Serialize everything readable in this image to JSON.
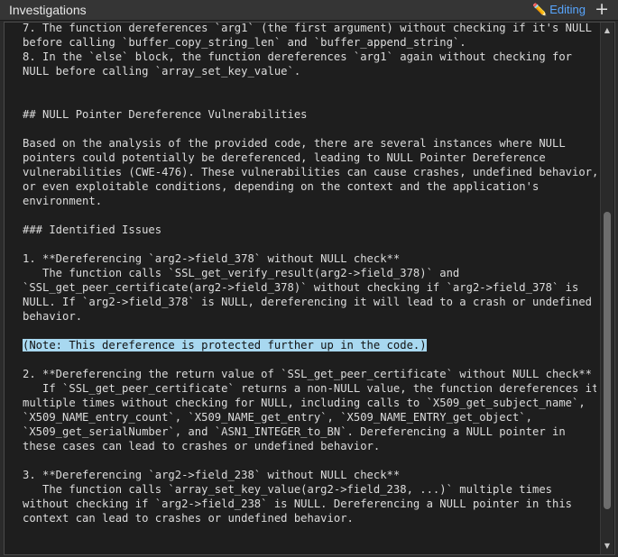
{
  "header": {
    "title": "Investigations",
    "editing_label": "Editing",
    "pencil_icon": "pencil-icon",
    "add_icon": "plus-icon"
  },
  "document": {
    "lines": [
      "7. The function dereferences `arg1` (the first argument) without checking if it's NULL",
      "before calling `buffer_copy_string_len` and `buffer_append_string`.",
      "8. In the `else` block, the function dereferences `arg1` again without checking for",
      "NULL before calling `array_set_key_value`.",
      "",
      "",
      "## NULL Pointer Dereference Vulnerabilities",
      "",
      "Based on the analysis of the provided code, there are several instances where NULL",
      "pointers could potentially be dereferenced, leading to NULL Pointer Dereference",
      "vulnerabilities (CWE-476). These vulnerabilities can cause crashes, undefined behavior,",
      "or even exploitable conditions, depending on the context and the application's",
      "environment.",
      "",
      "### Identified Issues",
      "",
      "1. **Dereferencing `arg2->field_378` without NULL check**",
      "   The function calls `SSL_get_verify_result(arg2->field_378)` and",
      "`SSL_get_peer_certificate(arg2->field_378)` without checking if `arg2->field_378` is",
      "NULL. If `arg2->field_378` is NULL, dereferencing it will lead to a crash or undefined",
      "behavior.",
      "",
      "(Note: This dereference is protected further up in the code.)",
      "",
      "2. **Dereferencing the return value of `SSL_get_peer_certificate` without NULL check**",
      "   If `SSL_get_peer_certificate` returns a non-NULL value, the function dereferences it",
      "multiple times without checking for NULL, including calls to `X509_get_subject_name`,",
      "`X509_NAME_entry_count`, `X509_NAME_get_entry`, `X509_NAME_ENTRY_get_object`,",
      "`X509_get_serialNumber`, and `ASN1_INTEGER_to_BN`. Dereferencing a NULL pointer in",
      "these cases can lead to crashes or undefined behavior.",
      "",
      "3. **Dereferencing `arg2->field_238` without NULL check**",
      "   The function calls `array_set_key_value(arg2->field_238, ...)` multiple times",
      "without checking if `arg2->field_238` is NULL. Dereferencing a NULL pointer in this",
      "context can lead to crashes or undefined behavior."
    ],
    "highlighted_line_index": 22,
    "highlight_color": "#a8d8f0"
  },
  "scrollbar": {
    "up_icon": "chevron-up-icon",
    "down_icon": "chevron-down-icon"
  }
}
